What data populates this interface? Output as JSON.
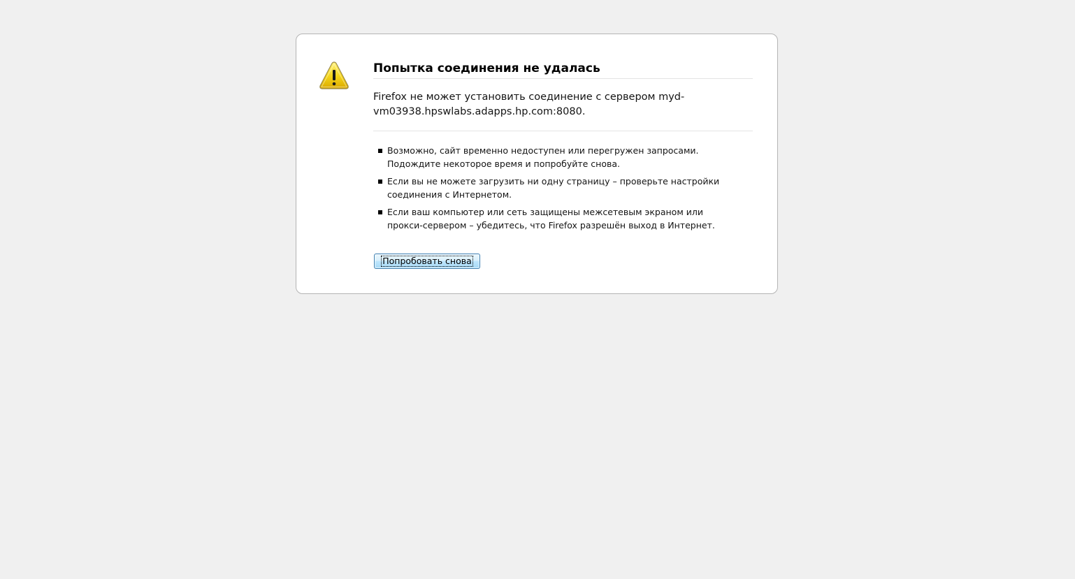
{
  "error": {
    "title": "Попытка соединения не удалась",
    "short_desc": "Firefox не может установить соединение с сервером myd-vm03938.hpswlabs.adapps.hp.com:8080.",
    "items": [
      "Возможно, сайт временно недоступен или перегружен запросами. Подождите некоторое время и попробуйте снова.",
      "Если вы не можете загрузить ни одну страницу – проверьте настройки соединения с Интернетом.",
      "Если ваш компьютер или сеть защищены межсетевым экраном или прокси-сервером – убедитесь, что Firefox разрешён выход в Интернет."
    ],
    "retry_label": "Попробовать снова",
    "icon": "warning-icon"
  },
  "colors": {
    "page_background": "#f0f0f0",
    "box_background": "#ffffff",
    "box_border": "#b4b4b4",
    "icon_fill": "#f5d416",
    "button_border": "#3c7fb1"
  }
}
